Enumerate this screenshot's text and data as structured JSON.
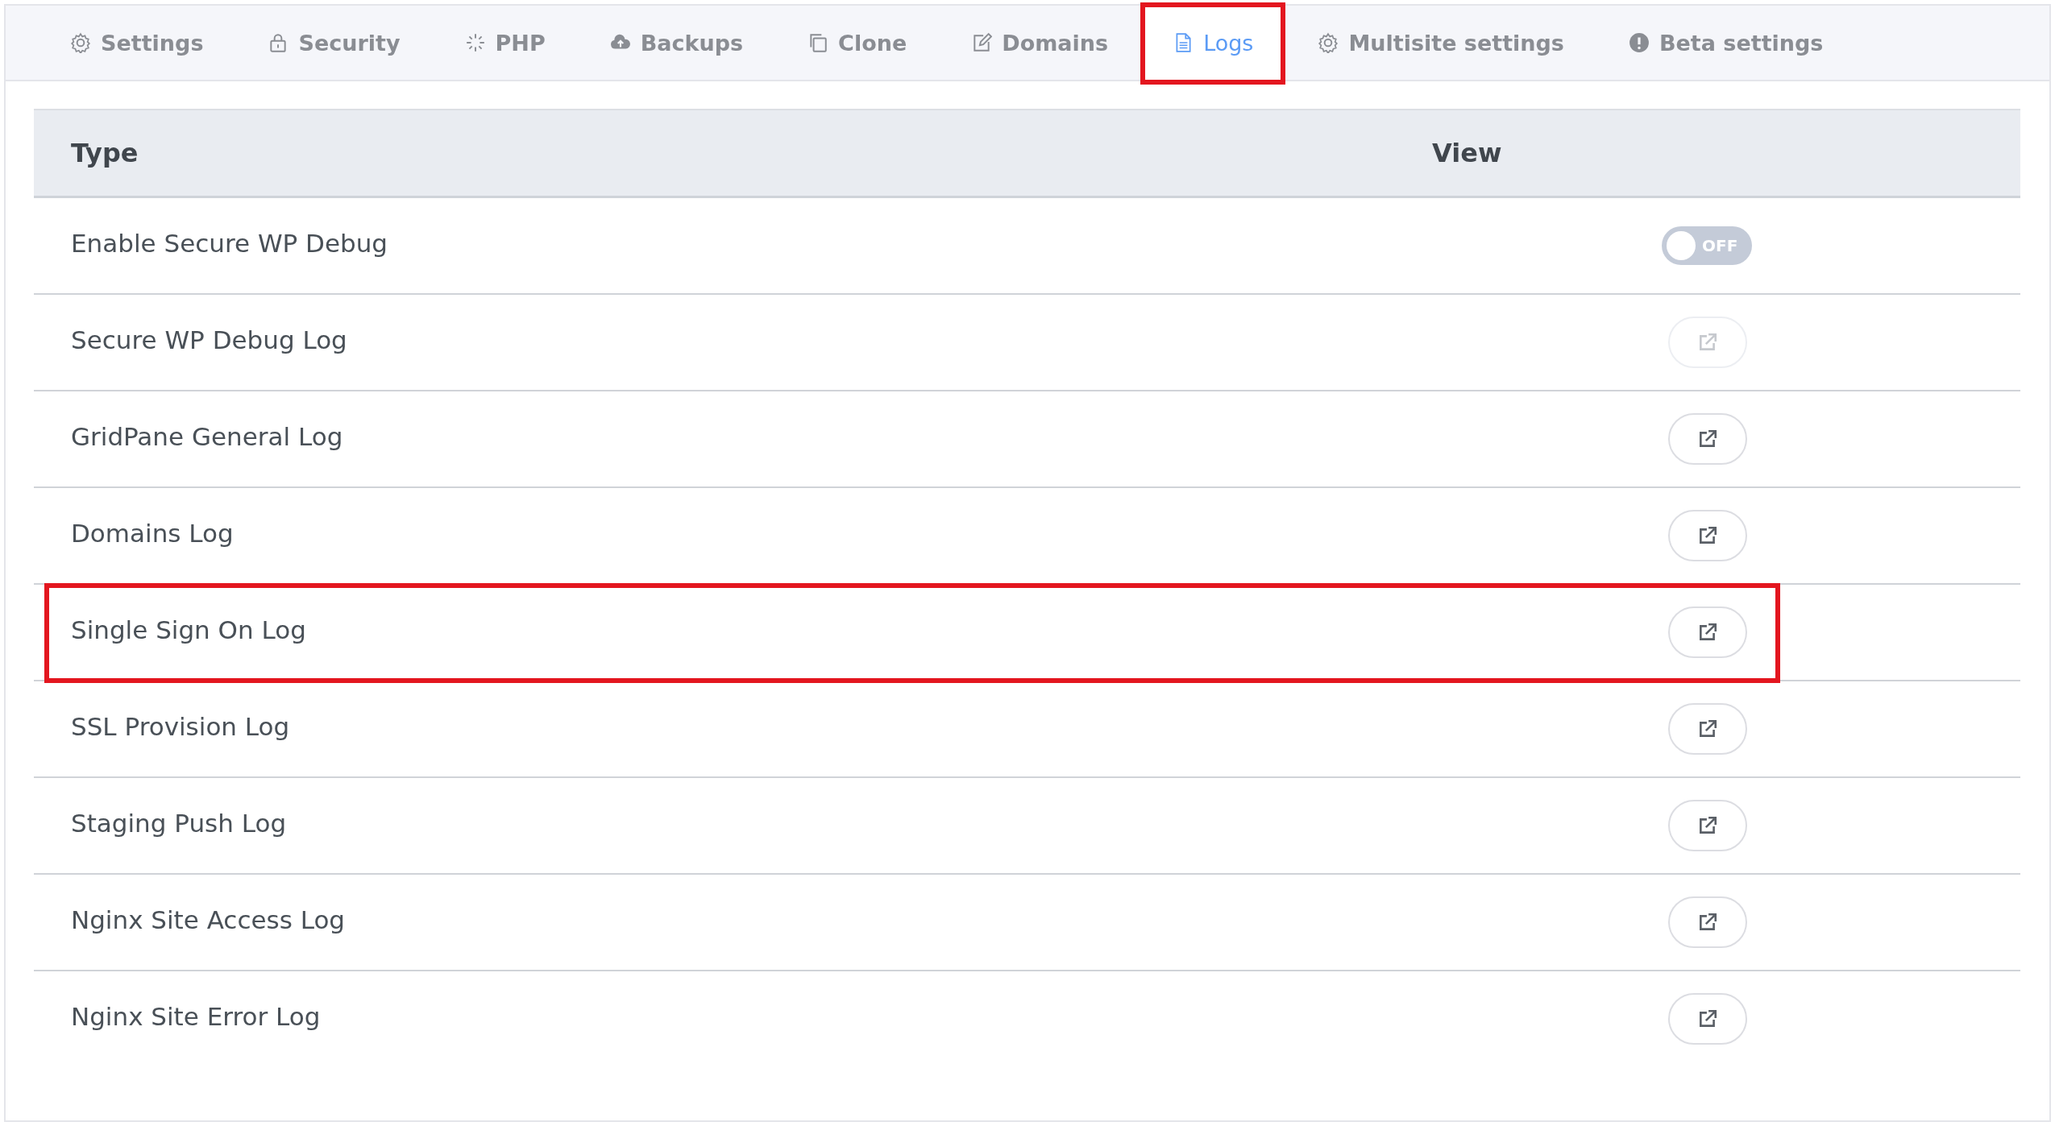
{
  "tabs": [
    {
      "label": "Settings",
      "selected": false,
      "highlighted": false
    },
    {
      "label": "Security",
      "selected": false,
      "highlighted": false
    },
    {
      "label": "PHP",
      "selected": false,
      "highlighted": false
    },
    {
      "label": "Backups",
      "selected": false,
      "highlighted": false
    },
    {
      "label": "Clone",
      "selected": false,
      "highlighted": false
    },
    {
      "label": "Domains",
      "selected": false,
      "highlighted": false
    },
    {
      "label": "Logs",
      "selected": true,
      "highlighted": true
    },
    {
      "label": "Multisite settings",
      "selected": false,
      "highlighted": false
    },
    {
      "label": "Beta settings",
      "selected": false,
      "highlighted": false
    }
  ],
  "table": {
    "columns": [
      "Type",
      "View"
    ],
    "rows": [
      {
        "type": "Enable Secure WP Debug",
        "kind": "toggle",
        "on": false,
        "toggle_label": "OFF",
        "highlighted": false
      },
      {
        "type": "Secure WP Debug Log",
        "kind": "link",
        "disabled": true,
        "highlighted": false
      },
      {
        "type": "GridPane General Log",
        "kind": "link",
        "disabled": false,
        "highlighted": false
      },
      {
        "type": "Domains Log",
        "kind": "link",
        "disabled": false,
        "highlighted": false
      },
      {
        "type": "Single Sign On Log",
        "kind": "link",
        "disabled": false,
        "highlighted": true
      },
      {
        "type": "SSL Provision Log",
        "kind": "link",
        "disabled": false,
        "highlighted": false
      },
      {
        "type": "Staging Push Log",
        "kind": "link",
        "disabled": false,
        "highlighted": false
      },
      {
        "type": "Nginx Site Access Log",
        "kind": "link",
        "disabled": false,
        "highlighted": false
      },
      {
        "type": "Nginx Site Error Log",
        "kind": "link",
        "disabled": false,
        "highlighted": false
      }
    ]
  }
}
